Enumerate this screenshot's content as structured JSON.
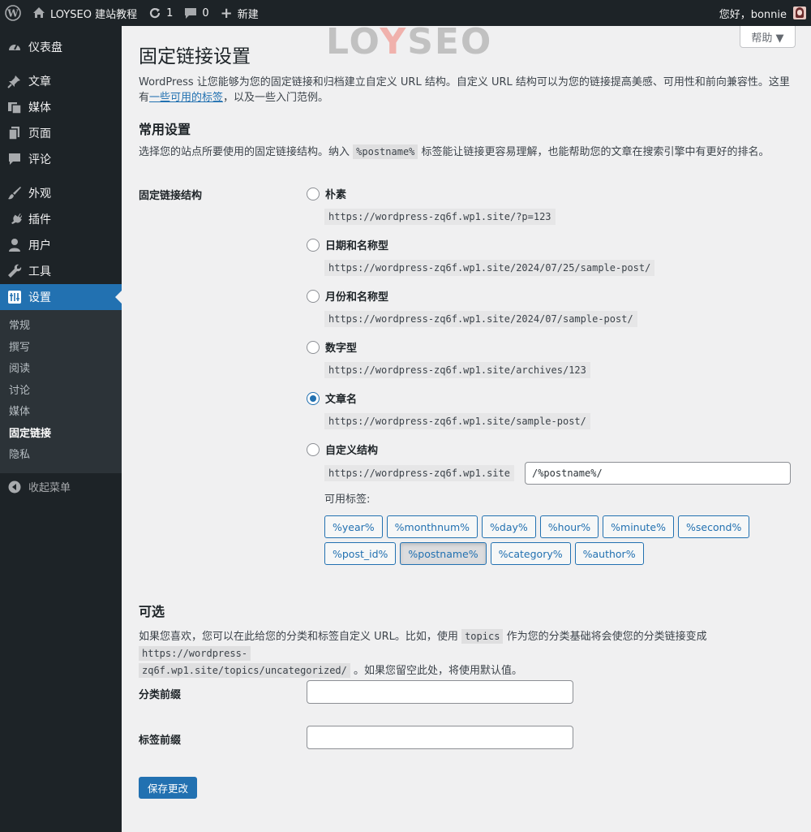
{
  "adminbar": {
    "site_name": "LOYSEO 建站教程",
    "updates_count": "1",
    "comments_count": "0",
    "new_label": "新建",
    "greeting": "您好，bonnie"
  },
  "watermark": "LOYSEO",
  "sidebar": {
    "items": [
      {
        "label": "仪表盘",
        "icon": "dashboard-icon"
      },
      {
        "label": "文章",
        "icon": "pin-icon"
      },
      {
        "label": "媒体",
        "icon": "media-icon"
      },
      {
        "label": "页面",
        "icon": "page-icon"
      },
      {
        "label": "评论",
        "icon": "comment-icon"
      },
      {
        "label": "外观",
        "icon": "brush-icon"
      },
      {
        "label": "插件",
        "icon": "plugin-icon"
      },
      {
        "label": "用户",
        "icon": "user-icon"
      },
      {
        "label": "工具",
        "icon": "wrench-icon"
      },
      {
        "label": "设置",
        "icon": "settings-icon"
      }
    ],
    "submenu": [
      "常规",
      "撰写",
      "阅读",
      "讨论",
      "媒体",
      "固定链接",
      "隐私"
    ],
    "collapse_label": "收起菜单"
  },
  "help_label": "帮助 ▼",
  "page": {
    "title": "固定链接设置",
    "intro_before_link": "WordPress 让您能够为您的固定链接和归档建立自定义 URL 结构。自定义 URL 结构可以为您的链接提高美感、可用性和前向兼容性。这里有",
    "intro_link": "一些可用的标签",
    "intro_after_link": "，以及一些入门范例。",
    "common_heading": "常用设置",
    "common_desc_before": "选择您的站点所要使用的固定链接结构。纳入",
    "common_desc_code": "%postname%",
    "common_desc_after": "标签能让链接更容易理解，也能帮助您的文章在搜索引擎中有更好的排名。",
    "structure_label": "固定链接结构",
    "options": [
      {
        "label": "朴素",
        "url": "https://wordpress-zq6f.wp1.site/?p=123",
        "checked": false
      },
      {
        "label": "日期和名称型",
        "url": "https://wordpress-zq6f.wp1.site/2024/07/25/sample-post/",
        "checked": false
      },
      {
        "label": "月份和名称型",
        "url": "https://wordpress-zq6f.wp1.site/2024/07/sample-post/",
        "checked": false
      },
      {
        "label": "数字型",
        "url": "https://wordpress-zq6f.wp1.site/archives/123",
        "checked": false
      },
      {
        "label": "文章名",
        "url": "https://wordpress-zq6f.wp1.site/sample-post/",
        "checked": true
      },
      {
        "label": "自定义结构",
        "url": "",
        "checked": false
      }
    ],
    "custom_base": "https://wordpress-zq6f.wp1.site",
    "custom_value": "/%postname%/",
    "tags_label": "可用标签:",
    "tags": [
      "%year%",
      "%monthnum%",
      "%day%",
      "%hour%",
      "%minute%",
      "%second%",
      "%post_id%",
      "%postname%",
      "%category%",
      "%author%"
    ],
    "optional_heading": "可选",
    "optional_desc_1": "如果您喜欢，您可以在此给您的分类和标签自定义 URL。比如，使用",
    "optional_code_1": "topics",
    "optional_desc_2": "作为您的分类基础将会使您的分类链接变成",
    "optional_code_2a": "https://wordpress-",
    "optional_code_2b": "zq6f.wp1.site/topics/uncategorized/",
    "optional_desc_3": "。如果您留空此处，将使用默认值。",
    "category_base_label": "分类前缀",
    "tag_base_label": "标签前缀",
    "save_label": "保存更改"
  }
}
